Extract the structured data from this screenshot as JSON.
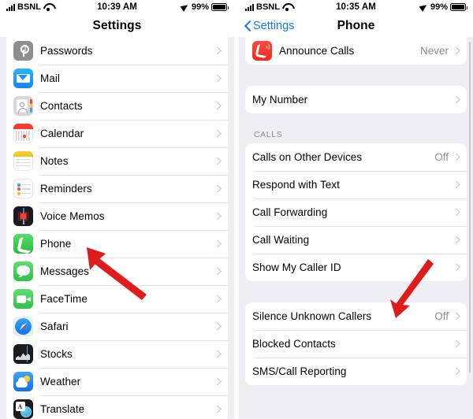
{
  "left_phone": {
    "status_bar": {
      "carrier": "BSNL",
      "time": "10:39 AM",
      "battery_percent": "99%",
      "wifi_icon": "wifi-icon",
      "signal_icon": "cellular-bars-icon",
      "location_icon": "location-arrow-icon",
      "battery_icon": "battery-icon"
    },
    "nav": {
      "title": "Settings"
    },
    "rows": [
      {
        "label": "Passwords",
        "icon": "passwords-icon",
        "value": ""
      },
      {
        "label": "Mail",
        "icon": "mail-icon",
        "value": ""
      },
      {
        "label": "Contacts",
        "icon": "contacts-icon",
        "value": ""
      },
      {
        "label": "Calendar",
        "icon": "calendar-icon",
        "value": ""
      },
      {
        "label": "Notes",
        "icon": "notes-icon",
        "value": ""
      },
      {
        "label": "Reminders",
        "icon": "reminders-icon",
        "value": ""
      },
      {
        "label": "Voice Memos",
        "icon": "voice-memos-icon",
        "value": ""
      },
      {
        "label": "Phone",
        "icon": "phone-icon",
        "value": ""
      },
      {
        "label": "Messages",
        "icon": "messages-icon",
        "value": ""
      },
      {
        "label": "FaceTime",
        "icon": "facetime-icon",
        "value": ""
      },
      {
        "label": "Safari",
        "icon": "safari-icon",
        "value": ""
      },
      {
        "label": "Stocks",
        "icon": "stocks-icon",
        "value": ""
      },
      {
        "label": "Weather",
        "icon": "weather-icon",
        "value": ""
      },
      {
        "label": "Translate",
        "icon": "translate-icon",
        "value": ""
      }
    ]
  },
  "right_phone": {
    "status_bar": {
      "carrier": "BSNL",
      "time": "10:35 AM",
      "battery_percent": "99%",
      "wifi_icon": "wifi-icon",
      "signal_icon": "cellular-bars-icon",
      "location_icon": "location-arrow-icon",
      "battery_icon": "battery-icon"
    },
    "nav": {
      "back_label": "Settings",
      "title": "Phone"
    },
    "section_announce": {
      "rows": [
        {
          "label": "Announce Calls",
          "icon": "announce-calls-icon",
          "value": "Never"
        }
      ]
    },
    "section_mynumber": {
      "rows": [
        {
          "label": "My Number",
          "value": ""
        }
      ]
    },
    "section_calls": {
      "header": "CALLS",
      "rows": [
        {
          "label": "Calls on Other Devices",
          "value": "Off"
        },
        {
          "label": "Respond with Text",
          "value": ""
        },
        {
          "label": "Call Forwarding",
          "value": ""
        },
        {
          "label": "Call Waiting",
          "value": ""
        },
        {
          "label": "Show My Caller ID",
          "value": ""
        }
      ]
    },
    "section_silence": {
      "rows": [
        {
          "label": "Silence Unknown Callers",
          "value": "Off"
        },
        {
          "label": "Blocked Contacts",
          "value": ""
        },
        {
          "label": "SMS/Call Reporting",
          "value": ""
        }
      ]
    }
  },
  "annotations": {
    "arrow_color": "#e01b1b",
    "arrow_left": {
      "name": "arrow-pointing-to-phone",
      "target": "Phone"
    },
    "arrow_right": {
      "name": "arrow-pointing-to-silence-unknown-callers",
      "target": "Silence Unknown Callers"
    }
  },
  "theme": {
    "accent_blue": "#0a7cf3",
    "page_bg": "#efeef3",
    "card_bg": "#ffffff",
    "secondary_text": "#8b8b91"
  }
}
